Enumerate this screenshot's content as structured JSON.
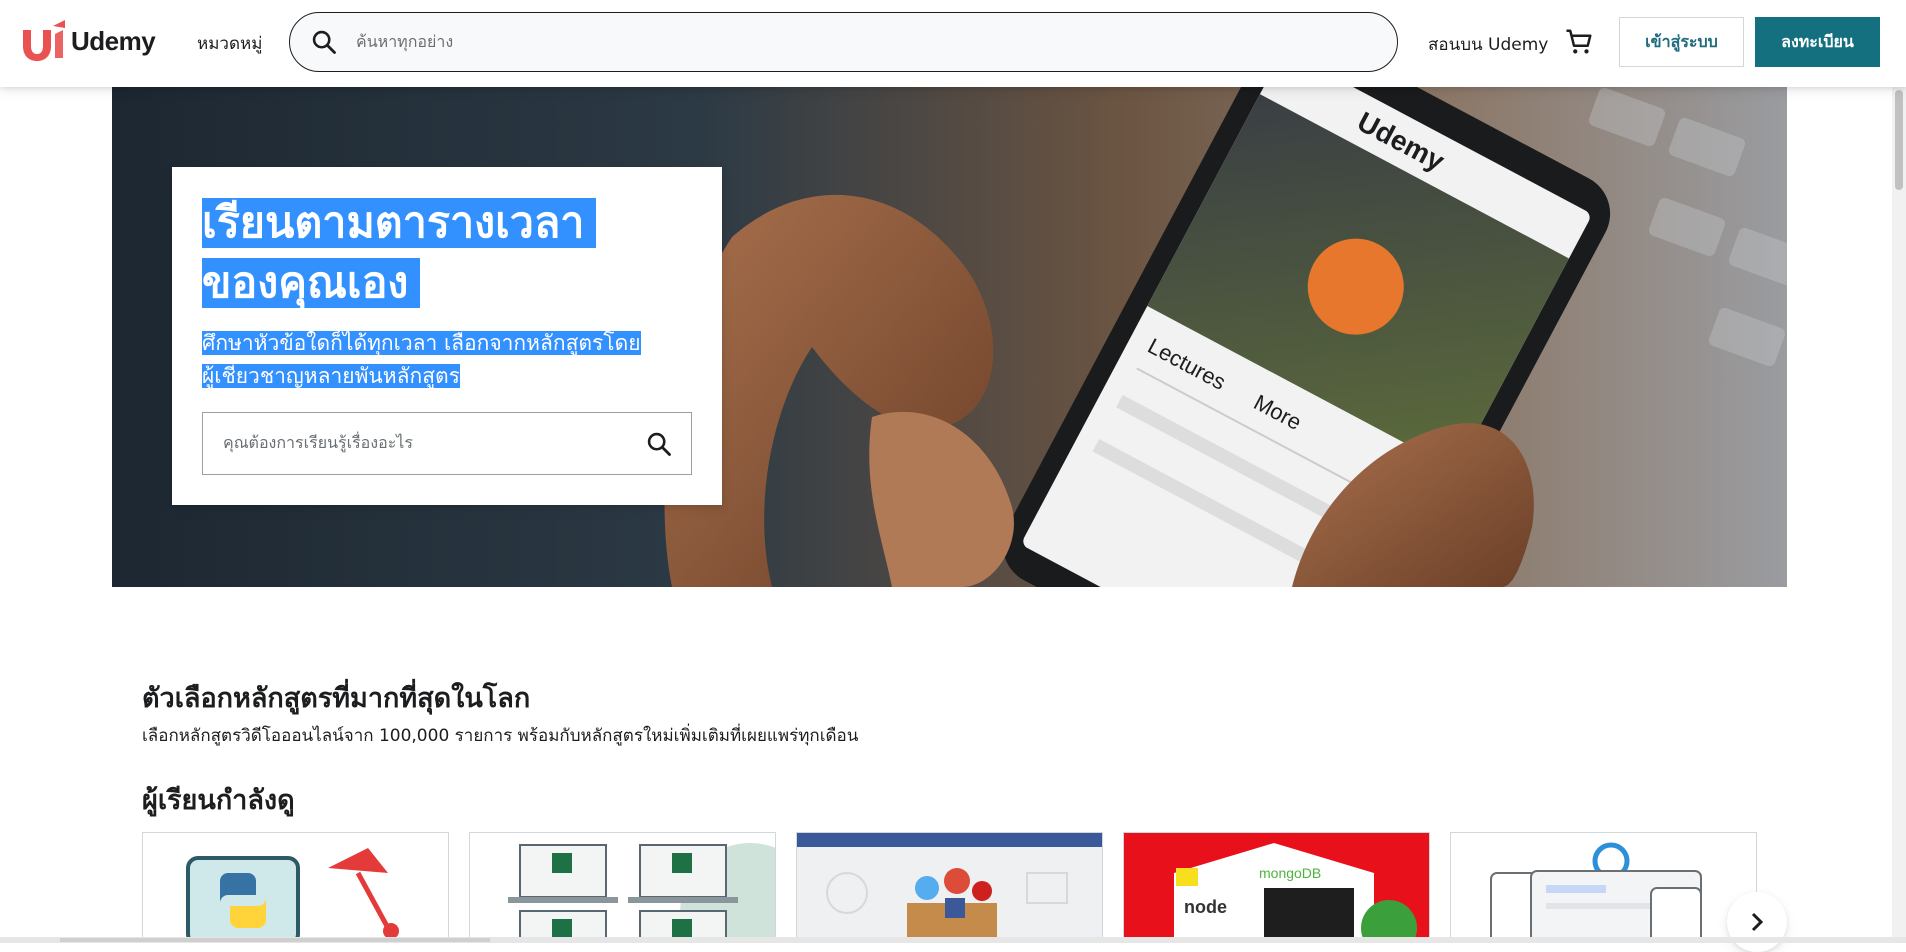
{
  "header": {
    "logo_text": "Udemy",
    "categories_label": "หมวดหมู่",
    "search_placeholder": "ค้นหาทุกอย่าง",
    "teach_label": "สอนบน Udemy",
    "login_label": "เข้าสู่ระบบ",
    "signup_label": "ลงทะเบียน",
    "icons": {
      "search": "search-icon",
      "cart": "cart-icon"
    }
  },
  "hero": {
    "title_line1": "เรียนตามตารางเวลา",
    "title_line2": "ของคุณเอง",
    "subtitle_line1": "ศึกษาหัวข้อใดก็ได้ทุกเวลา เลือกจากหลักสูตรโดย",
    "subtitle_line2": "ผู้เชี่ยวชาญหลายพันหลักสูตร",
    "search_placeholder": "คุณต้องการเรียนรู้เรื่องอะไร",
    "phone_brand": "Udemy",
    "phone_tabs": [
      "Lectures",
      "More"
    ]
  },
  "section": {
    "title": "ตัวเลือกหลักสูตรที่มากที่สุดในโลก",
    "description": "เลือกหลักสูตรวิดีโอออนไลน์จาก 100,000 รายการ พร้อมกับหลักสูตรใหม่เพิ่มเติมที่เผยแพร่ทุกเดือน",
    "students_title": "ผู้เรียนกำลังดู"
  },
  "courses": [
    {
      "name": "python-course-card"
    },
    {
      "name": "excel-course-card"
    },
    {
      "name": "social-media-course-card"
    },
    {
      "name": "web-dev-course-card"
    },
    {
      "name": "ui-design-course-card"
    }
  ],
  "colors": {
    "brand": "#a435f0",
    "logo_red": "#ea5252",
    "selection": "#3390ff",
    "signup_bg": "#14707f"
  }
}
